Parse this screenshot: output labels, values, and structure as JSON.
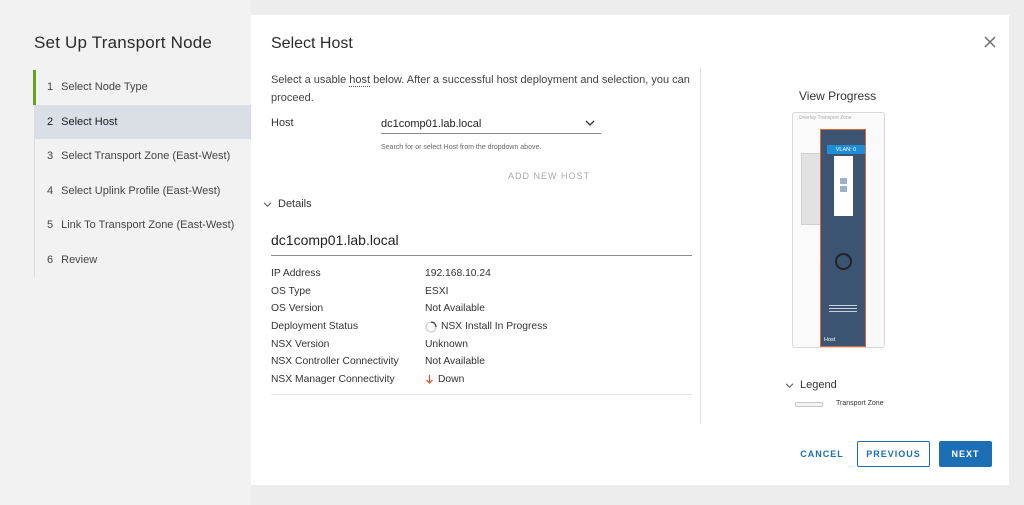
{
  "wizard": {
    "title": "Set Up Transport Node",
    "steps": [
      {
        "num": "1",
        "label": "Select Node Type"
      },
      {
        "num": "2",
        "label": "Select Host"
      },
      {
        "num": "3",
        "label": "Select Transport Zone (East-West)"
      },
      {
        "num": "4",
        "label": "Select Uplink Profile (East-West)"
      },
      {
        "num": "5",
        "label": "Link To Transport Zone (East-West)"
      },
      {
        "num": "6",
        "label": "Review"
      }
    ]
  },
  "main": {
    "title": "Select Host",
    "intro_before": "Select a usable ",
    "intro_link": "host",
    "intro_after": " below. After a successful host deployment and selection, you can proceed.",
    "host_label": "Host",
    "host_value": "dc1comp01.lab.local",
    "host_hint": "Search for or select Host from the dropdown above.",
    "add_host": "ADD NEW HOST",
    "details_toggle": "Details",
    "details_title": "dc1comp01.lab.local",
    "details": [
      {
        "key": "IP Address",
        "value": "192.168.10.24"
      },
      {
        "key": "OS Type",
        "value": "ESXI"
      },
      {
        "key": "OS Version",
        "value": "Not Available"
      },
      {
        "key": "Deployment Status",
        "value": "NSX Install In Progress"
      },
      {
        "key": "NSX Version",
        "value": "Unknown"
      },
      {
        "key": "NSX Controller Connectivity",
        "value": "Not Available"
      },
      {
        "key": "NSX Manager Connectivity",
        "value": "Down"
      }
    ]
  },
  "progress": {
    "title": "View Progress",
    "tz_label": "Overlay Transport Zone",
    "vlan_tag": "VLAN: 0",
    "host_name": "Host",
    "legend_toggle": "Legend",
    "legend_item": "Transport Zone"
  },
  "footer": {
    "cancel": "CANCEL",
    "previous": "PREVIOUS",
    "next": "NEXT"
  },
  "colors": {
    "accent": "#1c6fb5",
    "done_step": "#62a420",
    "down_arrow": "#e0512d"
  }
}
